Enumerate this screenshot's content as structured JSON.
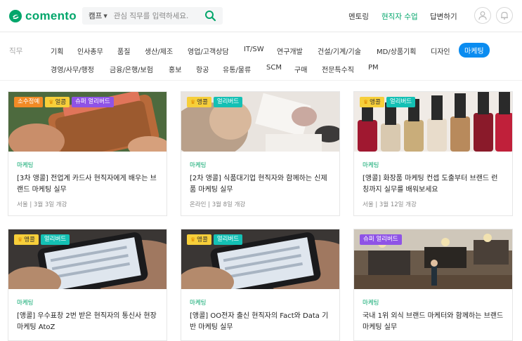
{
  "header": {
    "logo_text": "comento",
    "search_category": "캠프",
    "search_placeholder": "관심 직무를 입력하세요.",
    "nav": [
      "멘토링",
      "현직자 수업",
      "답변하기"
    ],
    "colors": {
      "brand": "#03a66b",
      "accent_blue": "#0b8cf0"
    }
  },
  "categories": {
    "label": "직무",
    "row1": [
      "기획",
      "인사총무",
      "품질",
      "생산/제조",
      "영업/고객상담",
      "IT/SW",
      "연구개발",
      "건설/기계/기술",
      "MD/상품기획",
      "디자인",
      "마케팅"
    ],
    "row2": [
      "경영/사무/행정",
      "금융/은행/보험",
      "홍보",
      "항공",
      "유통/물류",
      "SCM",
      "구매",
      "전문특수직",
      "PM"
    ],
    "active": "마케팅"
  },
  "cards": [
    {
      "badges": [
        "소수정예",
        "얼콤",
        "슈퍼 얼리버드"
      ],
      "category": "마케팅",
      "title": "[3차 앵콜] 전업계 카드사 현직자에게 배우는 브랜드 마케팅 실무",
      "meta": "서울 | 3월 3일 개강",
      "image": "wallet"
    },
    {
      "badges": [
        "앵콜",
        "얼리버드"
      ],
      "category": "마케팅",
      "title": "[2차 앵콜] 식품대기업 현직자와 함께하는 신제품 마케팅 실무",
      "meta": "온라인 | 3월 8일 개강",
      "image": "desk"
    },
    {
      "badges": [
        "앵콜",
        "얼리버드"
      ],
      "category": "마케팅",
      "title": "[앵콜] 화장품 마케팅 컨셉 도출부터 브랜드 런칭까지 실무를 배워보세요",
      "meta": "서울 | 3월 12일 개강",
      "image": "nailpolish"
    },
    {
      "badges": [
        "앵콜",
        "얼리버드"
      ],
      "category": "마케팅",
      "title": "[앵콜] 우수표창 2번 받은 현직자의 통신사 현장 마케팅 AtoZ",
      "meta": "",
      "image": "phone"
    },
    {
      "badges": [
        "앵콜",
        "얼리버드"
      ],
      "category": "마케팅",
      "title": "[앵콜] OO전자 출신 현직자의 Fact와 Data 기반 마케팅 실무",
      "meta": "",
      "image": "phone"
    },
    {
      "badges": [
        "슈퍼 얼리버드"
      ],
      "category": "마케팅",
      "title": "국내 1위 외식 브랜드 마케터와 함께하는 브랜드 마케팅 실무",
      "meta": "",
      "image": "cafe"
    }
  ]
}
